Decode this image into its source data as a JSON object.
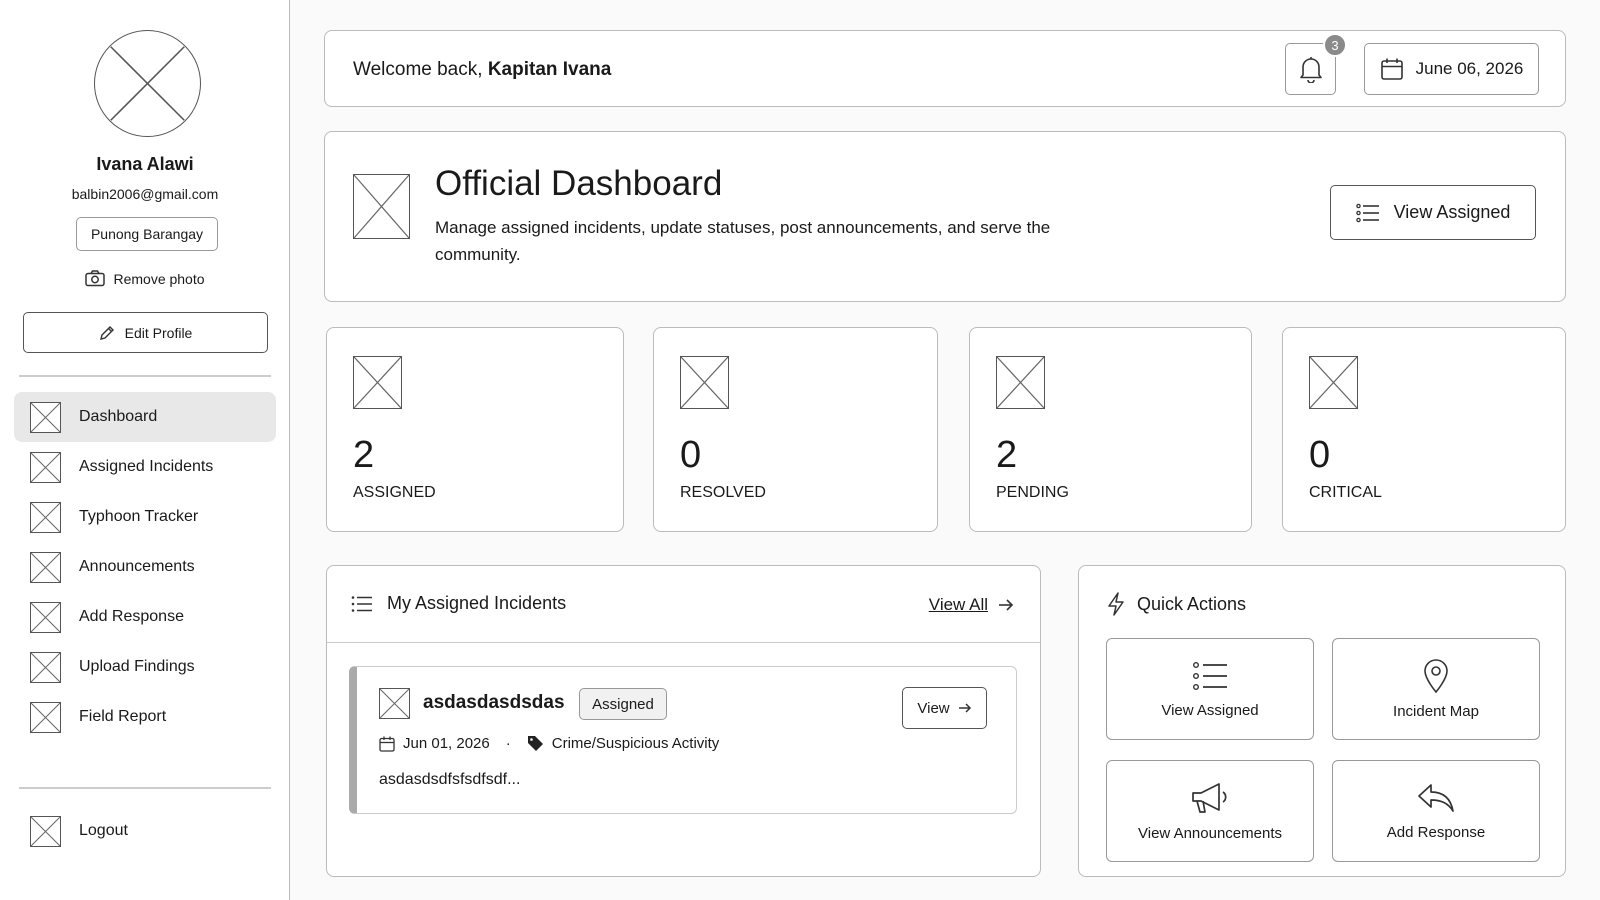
{
  "profile": {
    "name": "Ivana Alawi",
    "email": "balbin2006@gmail.com",
    "role": "Punong Barangay",
    "remove_photo": "Remove photo",
    "edit_profile": "Edit Profile"
  },
  "nav": {
    "items": [
      {
        "label": "Dashboard"
      },
      {
        "label": "Assigned Incidents"
      },
      {
        "label": "Typhoon Tracker"
      },
      {
        "label": "Announcements"
      },
      {
        "label": "Add Response"
      },
      {
        "label": "Upload Findings"
      },
      {
        "label": "Field Report"
      }
    ],
    "logout": "Logout"
  },
  "header": {
    "welcome_prefix": "Welcome back,",
    "user_name": "Kapitan Ivana",
    "notification_count": "3",
    "date": "June 06, 2026"
  },
  "hero": {
    "title": "Official Dashboard",
    "description": "Manage assigned incidents, update statuses, post announcements, and serve the community.",
    "button_label": "View Assigned"
  },
  "stats": [
    {
      "value": "2",
      "label": "ASSIGNED"
    },
    {
      "value": "0",
      "label": "RESOLVED"
    },
    {
      "value": "2",
      "label": "PENDING"
    },
    {
      "value": "0",
      "label": "CRITICAL"
    }
  ],
  "assigned_panel": {
    "title": "My Assigned Incidents",
    "view_all": "View All",
    "incident": {
      "title": "asdasdasdsdas",
      "status": "Assigned",
      "view_label": "View",
      "date": "Jun 01, 2026",
      "separator": "·",
      "category": "Crime/Suspicious Activity",
      "description": "asdasdsdfsfsdfsdf..."
    }
  },
  "quick_actions": {
    "title": "Quick Actions",
    "items": [
      {
        "label": "View Assigned",
        "icon": "list-icon"
      },
      {
        "label": "Incident Map",
        "icon": "map-pin-icon"
      },
      {
        "label": "View Announcements",
        "icon": "megaphone-icon"
      },
      {
        "label": "Add Response",
        "icon": "reply-icon"
      }
    ]
  }
}
